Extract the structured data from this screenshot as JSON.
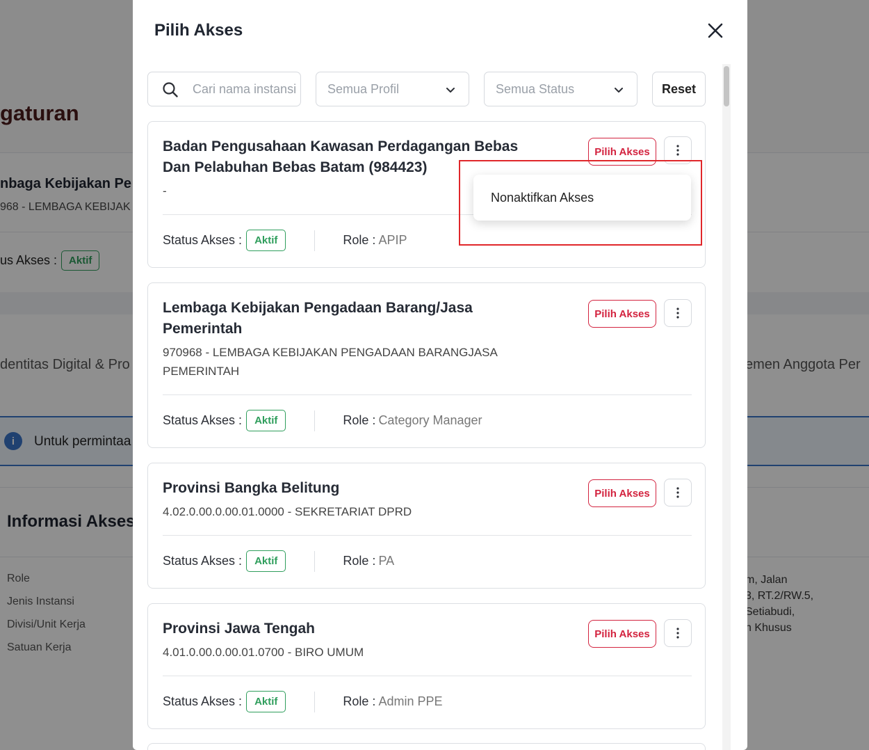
{
  "background": {
    "page_title": "gaturan",
    "sub_title": "nbaga Kebijakan Pe",
    "sub_code": "968 - LEMBAGA KEBIJAK",
    "status_label": "us Akses :",
    "status_value": "Aktif",
    "tab_left": "dentitas Digital & Pro",
    "tab_right": "emen Anggota Per",
    "info_text": "Untuk permintaa",
    "info_icon": "i",
    "section_title": "Informasi Akses",
    "fields": [
      "Role",
      "Jenis Instansi",
      "Divisi/Unit Kerja",
      "Satuan Kerja"
    ],
    "address_lines": [
      "m, Jalan",
      "3, RT.2/RW.5,",
      "Setiabudi,",
      "h Khusus"
    ]
  },
  "modal": {
    "title": "Pilih Akses",
    "close_icon": "close-icon",
    "search_placeholder": "Cari nama instansi",
    "profile_select": "Semua Profil",
    "status_select": "Semua Status",
    "reset_label": "Reset",
    "dropdown_item": "Nonaktifkan Akses",
    "cards": [
      {
        "title": "Badan Pengusahaan Kawasan Perdagangan Bebas Dan Pelabuhan Bebas Batam (984423)",
        "code": "-",
        "status_label": "Status Akses :",
        "status": "Aktif",
        "role_label": "Role :",
        "role": "APIP",
        "button": "Pilih Akses"
      },
      {
        "title": "Lembaga Kebijakan Pengadaan Barang/Jasa Pemerintah",
        "code": "970968 - LEMBAGA KEBIJAKAN PENGADAAN BARANGJASA PEMERINTAH",
        "status_label": "Status Akses :",
        "status": "Aktif",
        "role_label": "Role :",
        "role": "Category Manager",
        "button": "Pilih Akses"
      },
      {
        "title": "Provinsi Bangka Belitung",
        "code": "4.02.0.00.0.00.01.0000 - SEKRETARIAT DPRD",
        "status_label": "Status Akses :",
        "status": "Aktif",
        "role_label": "Role :",
        "role": "PA",
        "button": "Pilih Akses"
      },
      {
        "title": "Provinsi Jawa Tengah",
        "code": "4.01.0.00.0.00.01.0700 - BIRO UMUM",
        "status_label": "Status Akses :",
        "status": "Aktif",
        "role_label": "Role :",
        "role": "Admin PPE",
        "button": "Pilih Akses"
      }
    ]
  }
}
